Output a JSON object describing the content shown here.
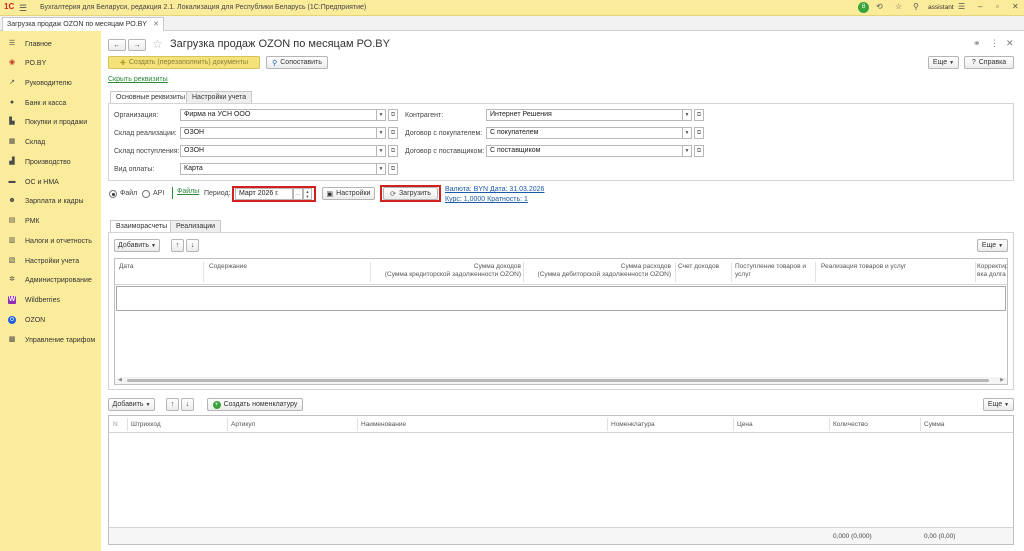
{
  "window": {
    "logo": "1С",
    "title": "Бухгалтерия для Беларуси, редакция 2.1. Локализация для Республики Беларусь   (1С:Предприятие)",
    "user": "assistant",
    "notification_count": "8"
  },
  "doc_tab": {
    "label": "Загрузка продаж OZON по месяцам РО.BY"
  },
  "sidebar": {
    "items": [
      {
        "label": "Главное",
        "icon": "menu-icon"
      },
      {
        "label": "РО.BY",
        "icon": "ro-icon"
      },
      {
        "label": "Руководителю",
        "icon": "chart-icon"
      },
      {
        "label": "Банк и касса",
        "icon": "bank-icon"
      },
      {
        "label": "Покупки и продажи",
        "icon": "cart-icon"
      },
      {
        "label": "Склад",
        "icon": "warehouse-icon"
      },
      {
        "label": "Производство",
        "icon": "factory-icon"
      },
      {
        "label": "ОС и НМА",
        "icon": "car-icon"
      },
      {
        "label": "Зарплата и кадры",
        "icon": "people-icon"
      },
      {
        "label": "РМК",
        "icon": "pos-icon"
      },
      {
        "label": "Налоги и отчетность",
        "icon": "taxes-icon"
      },
      {
        "label": "Настройки учета",
        "icon": "settings-doc-icon"
      },
      {
        "label": "Администрирование",
        "icon": "gear-icon"
      },
      {
        "label": "Wildberries",
        "icon": "wildberries-icon"
      },
      {
        "label": "OZON",
        "icon": "ozon-icon"
      },
      {
        "label": "Управление тарифом",
        "icon": "tariff-icon"
      }
    ]
  },
  "form": {
    "title": "Загрузка продаж OZON по месяцам РО.BY",
    "create_docs_button": "Создать (перезаполнить) документы",
    "compare_button": "Сопоставить",
    "more_button": "Еще",
    "help_button": "Справка",
    "hide_details_link": "Скрыть реквизиты",
    "tabs": [
      "Основные реквизиты",
      "Настройки учета"
    ],
    "fields": {
      "organization": {
        "label": "Организация:",
        "value": "Фирма на УСН ООО"
      },
      "sales_warehouse": {
        "label": "Склад реализации:",
        "value": "ОЗОН"
      },
      "receipt_warehouse": {
        "label": "Склад поступления:",
        "value": "ОЗОН"
      },
      "payment_type": {
        "label": "Вид оплаты:",
        "value": "Карта"
      },
      "counterparty": {
        "label": "Контрагент:",
        "value": "Интернет Решения"
      },
      "buyer_contract": {
        "label": "Договор с покупателем:",
        "value": "С покупателем"
      },
      "supplier_contract": {
        "label": "Договор с поставщиком:",
        "value": "С поставщиком"
      }
    },
    "source": {
      "file_label": "Файл",
      "api_label": "API",
      "files_link": "Файлы",
      "selected": "file"
    },
    "period": {
      "label": "Период:",
      "value": "Март 2026 г."
    },
    "settings_button": "Настройки",
    "load_button": "Загрузить",
    "currency_link": "Валюта: BYN Дата: 31.03.2026",
    "rate_link": "Курс: 1,0000 Кратность: 1"
  },
  "table1": {
    "tabs": [
      "Взаиморасчеты",
      "Реализации"
    ],
    "add_button": "Добавить",
    "more_button": "Еще",
    "columns": [
      "Дата",
      "Содержание",
      "Сумма доходов\n(Сумма кредиторской задолженности OZON)",
      "Сумма расходов\n(Сумма дебиторской задолженности OZON)",
      "Счет доходов",
      "Поступление товаров и\nуслуг",
      "Реализация товаров и услуг",
      "Корректир\nвка долга"
    ]
  },
  "table2": {
    "add_button": "Добавить",
    "create_nomenclature_button": "Создать номенклатуру",
    "more_button": "Еще",
    "columns": [
      "N",
      "Штрихкод",
      "Артикул",
      "Наименование",
      "Номенклатура",
      "Цена",
      "Количество",
      "Сумма"
    ],
    "totals": {
      "quantity": "0,000 (0,000)",
      "sum": "0,00 (0,00)"
    }
  },
  "colors": {
    "sidebar": "#fbec9c",
    "highlight": "#d21f1f",
    "link": "#1a5aa8",
    "create_button": "#f4e37a"
  }
}
